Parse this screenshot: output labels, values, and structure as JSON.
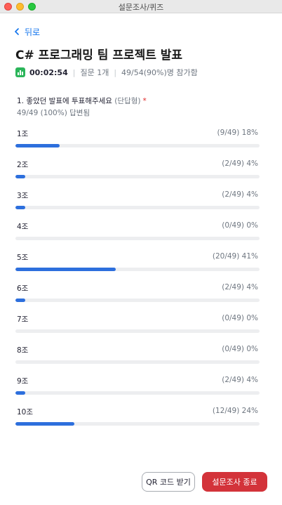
{
  "window": {
    "title": "설문조사/퀴즈"
  },
  "nav": {
    "back_label": "뒤로"
  },
  "poll": {
    "title": "C# 프로그래밍 팀 프로젝트 발표",
    "timer": "00:02:54",
    "question_count": "질문 1개",
    "participation": "49/54(90%)명 참가함"
  },
  "question": {
    "text": "1. 좋았던 발표에 투표해주세요",
    "type": "(단답형)",
    "required_mark": "*",
    "answered": "49/49 (100%) 답변됨"
  },
  "options": [
    {
      "label": "1조",
      "stat": "(9/49) 18%",
      "fraction": 0.18
    },
    {
      "label": "2조",
      "stat": "(2/49) 4%",
      "fraction": 0.04
    },
    {
      "label": "3조",
      "stat": "(2/49) 4%",
      "fraction": 0.04
    },
    {
      "label": "4조",
      "stat": "(0/49) 0%",
      "fraction": 0.0
    },
    {
      "label": "5조",
      "stat": "(20/49) 41%",
      "fraction": 0.41
    },
    {
      "label": "6조",
      "stat": "(2/49) 4%",
      "fraction": 0.04
    },
    {
      "label": "7조",
      "stat": "(0/49) 0%",
      "fraction": 0.0
    },
    {
      "label": "8조",
      "stat": "(0/49) 0%",
      "fraction": 0.0
    },
    {
      "label": "9조",
      "stat": "(2/49) 4%",
      "fraction": 0.04
    },
    {
      "label": "10조",
      "stat": "(12/49) 24%",
      "fraction": 0.24
    }
  ],
  "footer": {
    "qr_label": "QR 코드 받기",
    "end_label": "설문조사 종료"
  },
  "colors": {
    "bar_fill": "#2d6fdd",
    "bar_track": "#edeef0",
    "end_button": "#d3333a",
    "link": "#0e72ed",
    "timer_icon": "#2bb55a"
  },
  "icons": {
    "back": "chevron-left-icon",
    "timer": "bar-chart-icon"
  }
}
